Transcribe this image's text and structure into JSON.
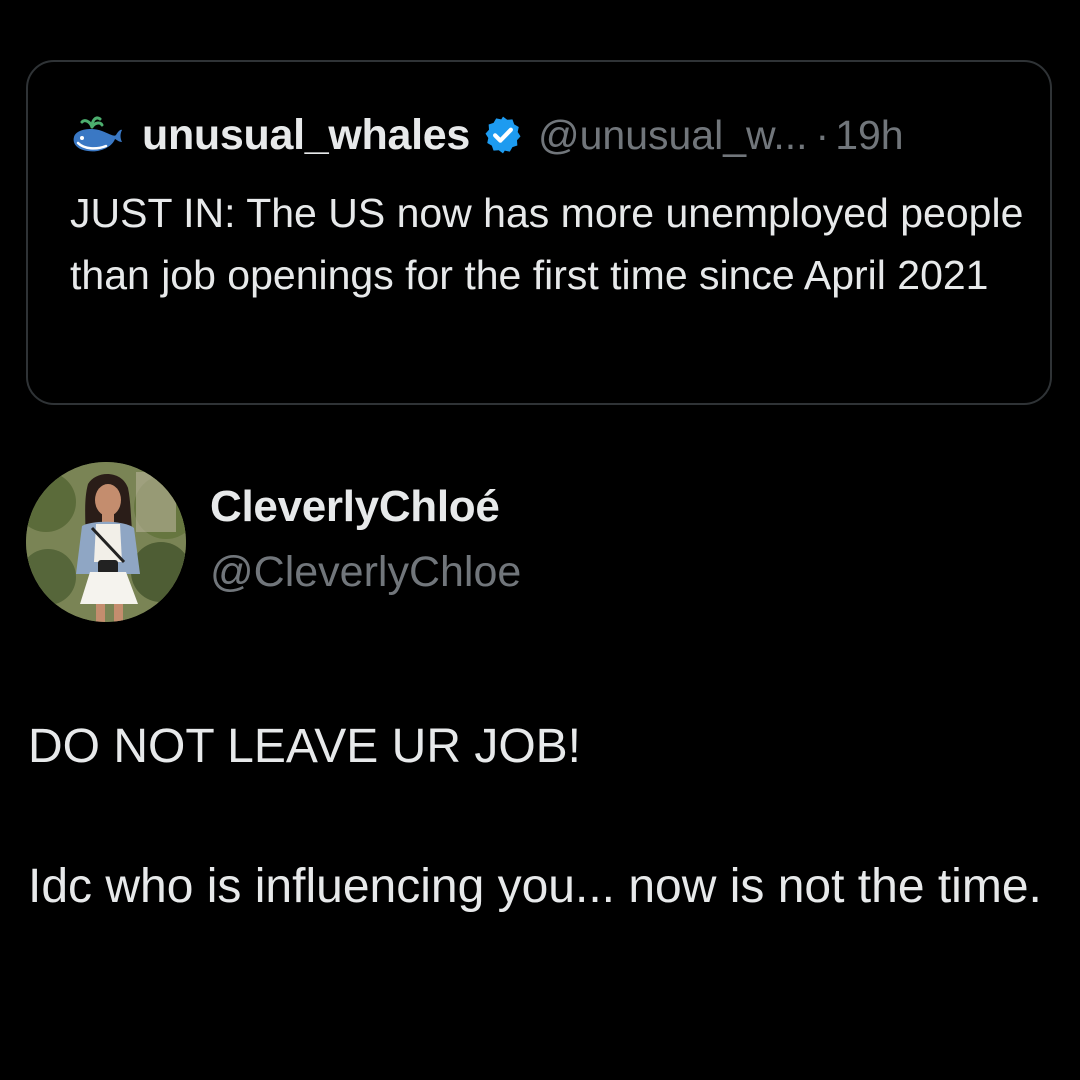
{
  "quoted_tweet": {
    "display_name": "unusual_whales",
    "handle": "@unusual_w...",
    "separator": "·",
    "time": "19h",
    "avatar_icon": "whale-icon",
    "verified_icon": "verified-badge-icon",
    "text": "JUST IN: The US now has more unemployed people than job openings for the first time since April 2021"
  },
  "author": {
    "display_name": "CleverlyChloé",
    "handle": "@CleverlyChloe",
    "avatar_icon": "profile-photo"
  },
  "tweet": {
    "line1": "DO NOT LEAVE UR JOB!",
    "line2": "Idc who is influencing you... now is not the time."
  },
  "colors": {
    "background": "#000000",
    "text_primary": "#e7e9ea",
    "text_secondary": "#71767b",
    "border": "#2f3336",
    "verified_blue": "#1d9bf0"
  }
}
